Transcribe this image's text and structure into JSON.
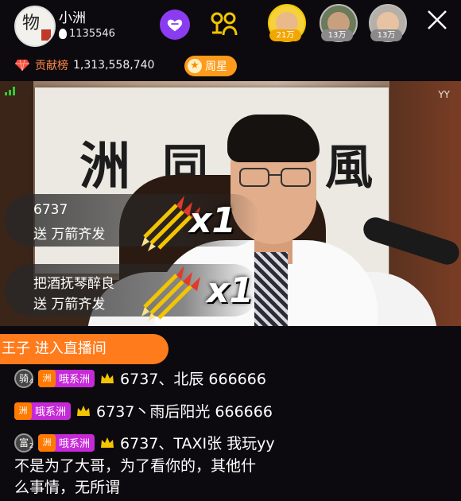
{
  "host": {
    "name": "小洲",
    "fans": "1135546",
    "avatar_glyph": "物",
    "icon": "flame-icon"
  },
  "top_actions": {
    "love_icon": "heart-icon",
    "mic_icon": "co-host-mic-icon",
    "close_icon": "close-icon"
  },
  "viewers": [
    {
      "badge": "21万",
      "color": "#f2a600"
    },
    {
      "badge": "13万",
      "color": "#8a8a8a"
    },
    {
      "badge": "13万",
      "color": "#8a8a8a"
    }
  ],
  "contribution": {
    "label": "贡献榜",
    "value": "1,313,558,740",
    "icon": "diamond-icon"
  },
  "weekly_star": {
    "label": "周星"
  },
  "video": {
    "watermark": "YY"
  },
  "gifts": [
    {
      "sender": "6737",
      "action": "送 万箭齐发",
      "multiplier": "x1"
    },
    {
      "sender": "把酒抚琴醉良",
      "action": "送 万箭齐发",
      "multiplier": "x1"
    }
  ],
  "entry_notice": "王子 进入直播间",
  "chat": [
    {
      "rank": "骑",
      "rank_lv": "4",
      "fan_lv": "洲",
      "fan_name": "哦系洲",
      "text": "6737、北辰 666666"
    },
    {
      "fan_lv": "洲",
      "fan_name": "哦系洲",
      "text": "6737丶雨后阳光 666666"
    },
    {
      "rank": "富",
      "rank_lv": "2",
      "fan_lv": "洲",
      "fan_name": "哦系洲",
      "text": "6737、TAXI张 我玩yy",
      "cont1": "不是为了大哥，为了看你的，其他什",
      "cont2": "么事情，无所谓"
    }
  ],
  "colors": {
    "accent_orange": "#ff7b1c",
    "fan_badge": "#c62ad8",
    "love_button": "#8b3cf0"
  }
}
